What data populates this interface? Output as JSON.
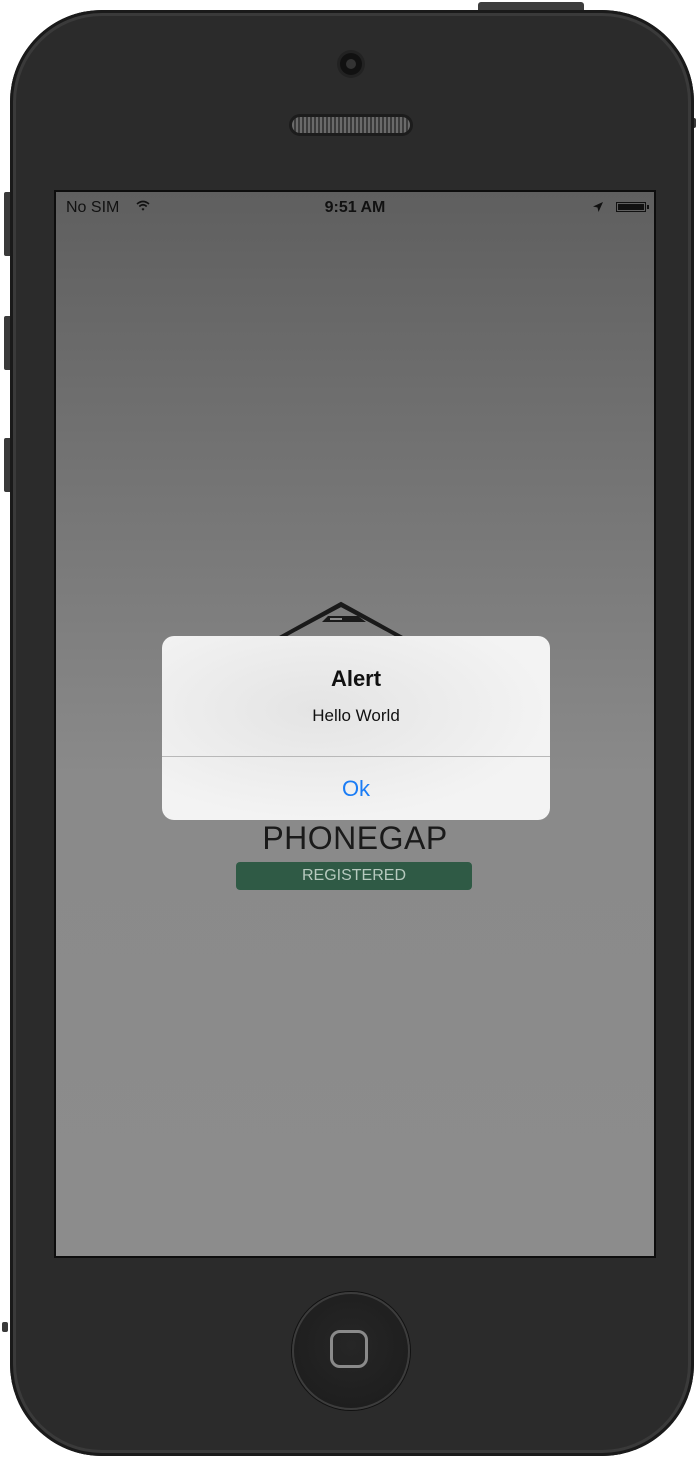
{
  "status_bar": {
    "carrier": "No SIM",
    "time": "9:51 AM",
    "wifi_icon": "wifi-icon",
    "location_icon": "location-arrow-icon",
    "battery_icon": "battery-full-icon"
  },
  "app": {
    "logo_icon": "phonegap-logo-icon",
    "title": "PHONEGAP",
    "badge": "REGISTERED",
    "badge_color": "#2f5a45"
  },
  "alert": {
    "title": "Alert",
    "message": "Hello World",
    "ok_label": "Ok",
    "button_color": "#1a7cf5"
  },
  "device": {
    "home_button_icon": "home-square-icon"
  }
}
